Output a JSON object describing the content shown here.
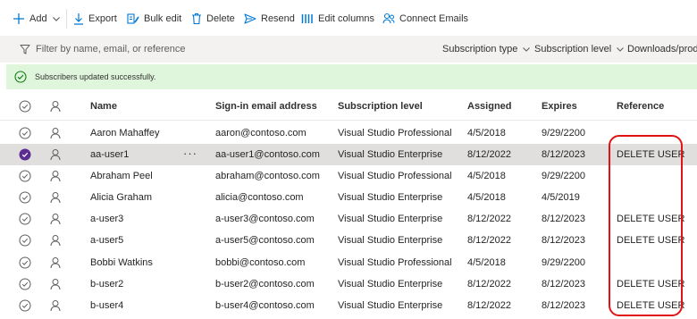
{
  "toolbar": {
    "add": "Add",
    "export": "Export",
    "bulk_edit": "Bulk edit",
    "delete": "Delete",
    "resend": "Resend",
    "edit_columns": "Edit columns",
    "connect_emails": "Connect Emails"
  },
  "filter": {
    "placeholder": "Filter by name, email, or reference",
    "subscription_type": "Subscription type",
    "subscription_level": "Subscription level",
    "downloads": "Downloads/prod"
  },
  "banner": {
    "message": "Subscribers updated successfully."
  },
  "columns": {
    "name": "Name",
    "email": "Sign-in email address",
    "level": "Subscription level",
    "assigned": "Assigned",
    "expires": "Expires",
    "reference": "Reference"
  },
  "rows": [
    {
      "name": "Aaron Mahaffey",
      "email": "aaron@contoso.com",
      "level": "Visual Studio Professional",
      "assigned": "4/5/2018",
      "expires": "9/29/2200",
      "reference": ""
    },
    {
      "name": "aa-user1",
      "email": "aa-user1@contoso.com",
      "level": "Visual Studio Enterprise",
      "assigned": "8/12/2022",
      "expires": "8/12/2023",
      "reference": "DELETE USER"
    },
    {
      "name": "Abraham Peel",
      "email": "abraham@contoso.com",
      "level": "Visual Studio Professional",
      "assigned": "4/5/2018",
      "expires": "9/29/2200",
      "reference": ""
    },
    {
      "name": "Alicia Graham",
      "email": "alicia@contoso.com",
      "level": "Visual Studio Enterprise",
      "assigned": "4/5/2018",
      "expires": "4/5/2019",
      "reference": ""
    },
    {
      "name": "a-user3",
      "email": "a-user3@contoso.com",
      "level": "Visual Studio Enterprise",
      "assigned": "8/12/2022",
      "expires": "8/12/2023",
      "reference": "DELETE USER"
    },
    {
      "name": "a-user5",
      "email": "a-user5@contoso.com",
      "level": "Visual Studio Enterprise",
      "assigned": "8/12/2022",
      "expires": "8/12/2023",
      "reference": "DELETE USER"
    },
    {
      "name": "Bobbi Watkins",
      "email": "bobbi@contoso.com",
      "level": "Visual Studio Professional",
      "assigned": "4/5/2018",
      "expires": "9/29/2200",
      "reference": ""
    },
    {
      "name": "b-user2",
      "email": "b-user2@contoso.com",
      "level": "Visual Studio Enterprise",
      "assigned": "8/12/2022",
      "expires": "8/12/2023",
      "reference": "DELETE USER"
    },
    {
      "name": "b-user4",
      "email": "b-user4@contoso.com",
      "level": "Visual Studio Enterprise",
      "assigned": "8/12/2022",
      "expires": "8/12/2023",
      "reference": "DELETE USER"
    }
  ],
  "more_actions": "···",
  "colors": {
    "accent": "#0078d4",
    "selected_check": "#5c2d91",
    "success_banner": "#dff6dd",
    "success_icon": "#107c10",
    "highlight": "#e31212"
  }
}
